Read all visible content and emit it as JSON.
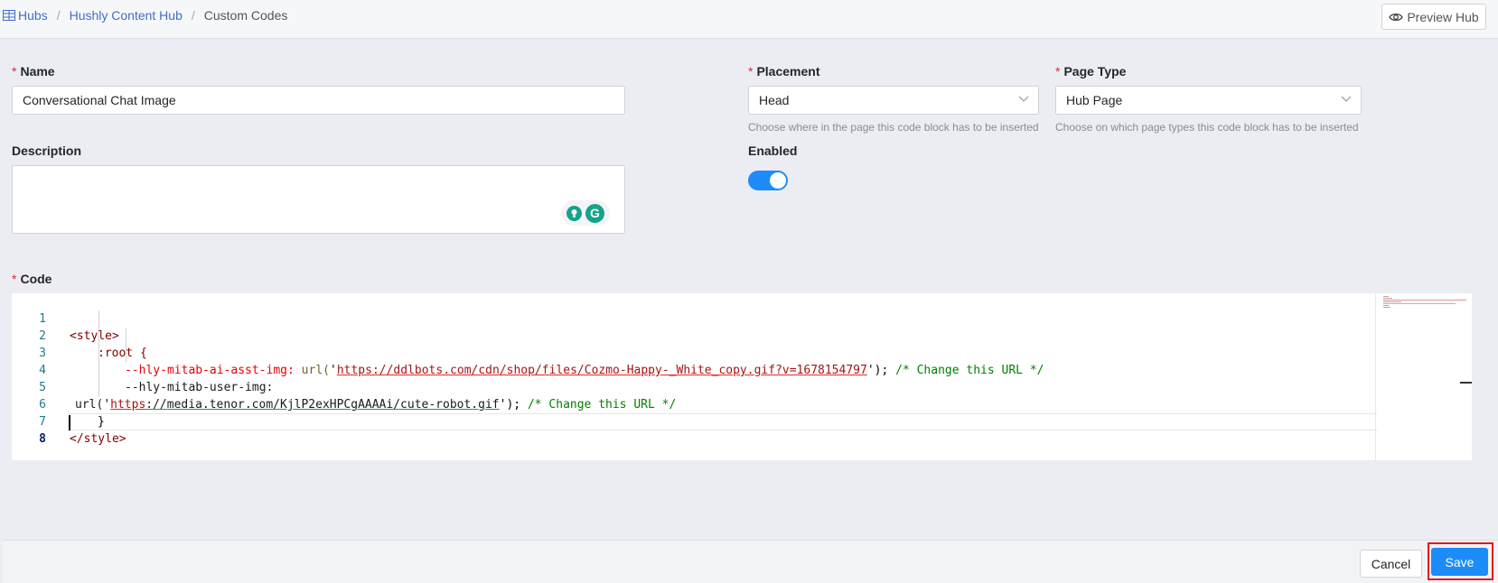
{
  "breadcrumb": {
    "hubs": "Hubs",
    "hub_name": "Hushly Content Hub",
    "current": "Custom Codes",
    "separator": "/"
  },
  "header": {
    "preview_label": "Preview Hub"
  },
  "form": {
    "required_mark": "*",
    "name_label": "Name",
    "name_value": "Conversational Chat Image",
    "description_label": "Description",
    "description_value": "",
    "placement_label": "Placement",
    "placement_value": "Head",
    "placement_help": "Choose where in the page this code block has to be inserted",
    "page_type_label": "Page Type",
    "page_type_value": "Hub Page",
    "page_type_help": "Choose on which page types this code block has to be inserted",
    "enabled_label": "Enabled",
    "enabled": true,
    "code_label": "Code"
  },
  "code": {
    "line_numbers": [
      "1",
      "2",
      "3",
      "4",
      "5",
      "6",
      "7",
      "8"
    ],
    "l1": "<style>",
    "l2": ":root {",
    "l3_prop": "--hly-mitab-ai-asst-img:",
    "l3_fn": "url(",
    "l3_q1": "'",
    "l3_url": "https://ddlbots.com/cdn/shop/files/Cozmo-Happy-_White_copy.gif?v=1678154797",
    "l3_q2": "'",
    "l3_end": ");",
    "l3_cmt": "/* Change this URL */",
    "l4": "--hly-mitab-user-img:",
    "l5_fn": "url(",
    "l5_q1": "'",
    "l5_scheme": "https",
    "l5_rest": "://media.tenor.com/KjlP2exHPCgAAAAi/cute-robot.gif",
    "l5_q2": "'",
    "l5_end": ");",
    "l5_cmt": "/* Change this URL */",
    "l6": "}",
    "l7": "</style>",
    "l8": ""
  },
  "footer": {
    "cancel_label": "Cancel",
    "save_label": "Save"
  },
  "colors": {
    "primary": "#1d8cf8",
    "required": "#e0282e",
    "highlight_box": "#e0181e"
  },
  "icons": [
    "grid-icon",
    "eye-icon",
    "chevron-down-icon",
    "grammarly-icon"
  ]
}
